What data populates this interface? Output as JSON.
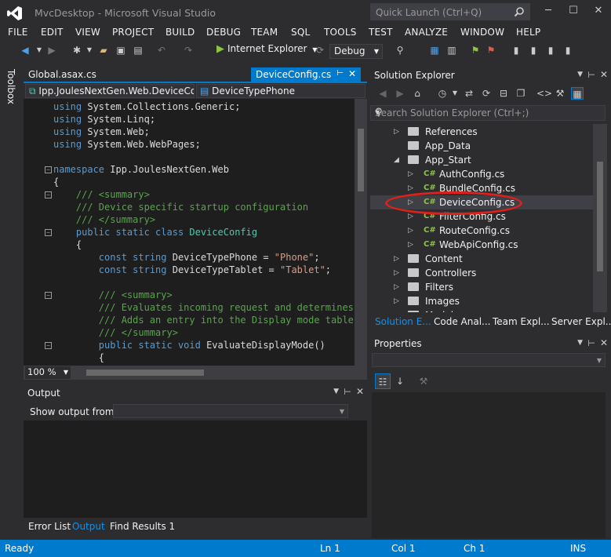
{
  "window": {
    "title": "MvcDesktop - Microsoft Visual Studio",
    "quick_launch_placeholder": "Quick Launch (Ctrl+Q)"
  },
  "menu": [
    "FILE",
    "EDIT",
    "VIEW",
    "PROJECT",
    "BUILD",
    "DEBUG",
    "TEAM",
    "SQL",
    "TOOLS",
    "TEST",
    "ANALYZE",
    "WINDOW",
    "HELP"
  ],
  "toolbar": {
    "run_target": "Internet Explorer",
    "configuration": "Debug"
  },
  "toolbox": {
    "label": "Toolbox"
  },
  "editor": {
    "tabs": [
      {
        "label": "Global.asax.cs",
        "active": false
      },
      {
        "label": "DeviceConfig.cs",
        "active": true
      }
    ],
    "nav_left": "Ipp.JoulesNextGen.Web.DeviceCor",
    "nav_right": "DeviceTypePhone",
    "zoom": "100 %",
    "code_lines": [
      "using System.Collections.Generic;",
      "using System.Linq;",
      "using System.Web;",
      "using System.Web.WebPages;",
      "",
      "namespace Ipp.JoulesNextGen.Web",
      "{",
      "    /// <summary>",
      "    /// Device specific startup configuration",
      "    /// </summary>",
      "    public static class DeviceConfig",
      "    {",
      "        const string DeviceTypePhone = \"Phone\";",
      "        const string DeviceTypeTablet = \"Tablet\";",
      "",
      "        /// <summary>",
      "        /// Evaluates incoming request and determines a",
      "        /// Adds an entry into the Display mode table",
      "        /// </summary>",
      "        public static void EvaluateDisplayMode()",
      "        {"
    ]
  },
  "output": {
    "title": "Output",
    "show_output_from": "Show output from:",
    "bottom_tabs": [
      "Error List",
      "Output",
      "Find Results 1"
    ],
    "active_tab": "Output"
  },
  "solution_explorer": {
    "title": "Solution Explorer",
    "search_placeholder": "Search Solution Explorer (Ctrl+;)",
    "tree": [
      {
        "label": "References",
        "indent": 1,
        "kind": "folder",
        "expander": "collapsed"
      },
      {
        "label": "App_Data",
        "indent": 1,
        "kind": "folder",
        "expander": "none"
      },
      {
        "label": "App_Start",
        "indent": 1,
        "kind": "folder",
        "expander": "expanded"
      },
      {
        "label": "AuthConfig.cs",
        "indent": 2,
        "kind": "cs",
        "expander": "collapsed"
      },
      {
        "label": "BundleConfig.cs",
        "indent": 2,
        "kind": "cs",
        "expander": "collapsed"
      },
      {
        "label": "DeviceConfig.cs",
        "indent": 2,
        "kind": "cs",
        "expander": "collapsed",
        "selected": true
      },
      {
        "label": "FilterConfig.cs",
        "indent": 2,
        "kind": "cs",
        "expander": "collapsed"
      },
      {
        "label": "RouteConfig.cs",
        "indent": 2,
        "kind": "cs",
        "expander": "collapsed"
      },
      {
        "label": "WebApiConfig.cs",
        "indent": 2,
        "kind": "cs",
        "expander": "collapsed"
      },
      {
        "label": "Content",
        "indent": 1,
        "kind": "folder",
        "expander": "collapsed"
      },
      {
        "label": "Controllers",
        "indent": 1,
        "kind": "folder",
        "expander": "collapsed"
      },
      {
        "label": "Filters",
        "indent": 1,
        "kind": "folder",
        "expander": "collapsed"
      },
      {
        "label": "Images",
        "indent": 1,
        "kind": "folder",
        "expander": "collapsed"
      },
      {
        "label": "Models",
        "indent": 1,
        "kind": "folder",
        "expander": "collapsed"
      }
    ],
    "tabs": [
      "Solution E...",
      "Code Anal...",
      "Team Expl...",
      "Server Expl..."
    ]
  },
  "properties": {
    "title": "Properties"
  },
  "status": {
    "left": "Ready",
    "ln": "Ln 1",
    "col": "Col 1",
    "ch": "Ch 1",
    "mode": "INS"
  },
  "colors": {
    "accent": "#007acc",
    "highlight_ellipse": "#e0201a",
    "background": "#2d2d30",
    "editor_bg": "#1e1e1e"
  }
}
